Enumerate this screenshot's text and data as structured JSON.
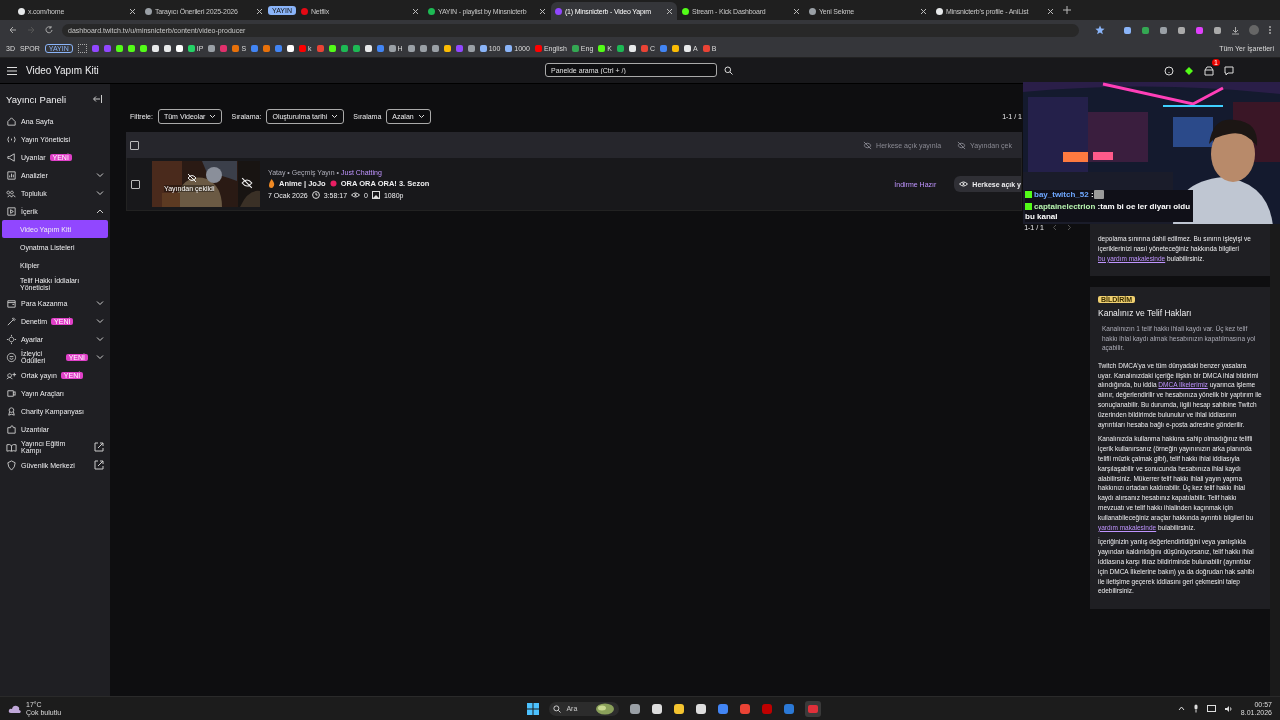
{
  "browser": {
    "tabs": [
      {
        "kind": "tab",
        "label": "x.com/home",
        "selected": false,
        "color": "#e7e9ea"
      },
      {
        "kind": "tab",
        "label": "Tarayıcı Önerileri 2025-2026",
        "selected": false,
        "color": "#9aa0a6"
      },
      {
        "kind": "group",
        "label": "YAYIN",
        "color": "#8ab4f8"
      },
      {
        "kind": "tab",
        "label": "Netflix",
        "selected": false,
        "color": "#e50914"
      },
      {
        "kind": "tab",
        "label": "YAYIN - playlist by Minsnicterb",
        "selected": false,
        "color": "#1db954"
      },
      {
        "kind": "tab",
        "label": "(1) Minsnicterb - Video Yapım",
        "selected": true,
        "color": "#9147ff"
      },
      {
        "kind": "tab",
        "label": "Stream - Kick Dashboard",
        "selected": false,
        "color": "#53fc18"
      },
      {
        "kind": "tab",
        "label": "Yeni Sekme",
        "selected": false,
        "color": "#9aa0a6"
      },
      {
        "kind": "tab",
        "label": "Minsnicterb's profile - AniList",
        "selected": false,
        "color": "#e7e9ea"
      }
    ],
    "url": "dashboard.twitch.tv/u/minsnicterb/content/video-producer",
    "bookmark_folders": [
      "3D",
      "SPOR"
    ],
    "bookmark_group": "YAYIN",
    "bookmarks": [
      {
        "color": "#9147ff"
      },
      {
        "color": "#9147ff"
      },
      {
        "color": "#53fc18"
      },
      {
        "color": "#53fc18"
      },
      {
        "color": "#53fc18"
      },
      {
        "color": "#e7e9ea"
      },
      {
        "color": "#e7e9ea"
      },
      {
        "color": "#ffffff"
      },
      {
        "color": "#25d366",
        "label": "IP"
      },
      {
        "color": "#9aa0a6"
      },
      {
        "color": "#e1306c"
      },
      {
        "color": "#e8710a",
        "label": "S"
      },
      {
        "color": "#4285f4"
      },
      {
        "color": "#e8710a"
      },
      {
        "color": "#4285f4"
      },
      {
        "color": "#ffffff"
      },
      {
        "color": "#ff0000",
        "label": "k"
      },
      {
        "color": "#ea4335"
      },
      {
        "color": "#53fc18"
      },
      {
        "color": "#1db954"
      },
      {
        "color": "#1db954"
      },
      {
        "color": "#e7e9ea"
      },
      {
        "color": "#4285f4"
      },
      {
        "color": "#9aa0a6",
        "label": "H"
      },
      {
        "color": "#9aa0a6"
      },
      {
        "color": "#9aa0a6"
      },
      {
        "color": "#9aa0a6"
      },
      {
        "color": "#fbbc04"
      },
      {
        "color": "#9147ff"
      },
      {
        "color": "#9aa0a6"
      },
      {
        "color": "#8ab4f8",
        "label": "100"
      },
      {
        "color": "#8ab4f8",
        "label": "1000"
      },
      {
        "color": "#ff0000",
        "label": "English"
      },
      {
        "color": "#34a853",
        "label": "Eng"
      },
      {
        "color": "#53fc18",
        "label": "K"
      },
      {
        "color": "#1db954"
      },
      {
        "color": "#e7e9ea"
      },
      {
        "color": "#ea4335",
        "label": "C"
      },
      {
        "color": "#4285f4"
      },
      {
        "color": "#fbbc04"
      },
      {
        "color": "#e7e9ea",
        "label": "A"
      },
      {
        "color": "#ea4335",
        "label": "B"
      }
    ],
    "all_bookmarks": "Tüm Yer İşaretleri"
  },
  "topbar": {
    "title": "Video Yapım Kiti",
    "search": {
      "placeholder": "Panelde arama (Ctrl + /)"
    },
    "notification_count": "1"
  },
  "sidebar": {
    "title": "Yayıncı Paneli",
    "items": [
      {
        "label": "Ana Sayfa",
        "selected": false
      },
      {
        "label": "Yayın Yöneticisi",
        "selected": false
      },
      {
        "label": "Uyarılar",
        "badge": "YENİ",
        "selected": false
      },
      {
        "label": "Analizler",
        "expanded": false,
        "selected": false
      },
      {
        "label": "Topluluk",
        "expanded": false,
        "selected": false
      },
      {
        "label": "İçerik",
        "expanded": true,
        "selected": false,
        "children": [
          {
            "label": "Video Yapım Kiti",
            "selected": true
          },
          {
            "label": "Oynatma Listeleri",
            "selected": false
          },
          {
            "label": "Klipler",
            "selected": false
          },
          {
            "label": "Telif Hakkı İddiaları Yöneticisi",
            "selected": false
          }
        ]
      },
      {
        "label": "Para Kazanma",
        "expanded": false,
        "selected": false
      },
      {
        "label": "Denetim",
        "badge": "YENİ",
        "expanded": false,
        "selected": false
      },
      {
        "label": "Ayarlar",
        "expanded": false,
        "selected": false
      },
      {
        "label": "İzleyici Ödülleri",
        "badge": "YENİ",
        "expanded": false,
        "selected": false
      },
      {
        "label": "Ortak yayın",
        "badge": "YENİ",
        "selected": false
      },
      {
        "label": "Yayın Araçları",
        "selected": false
      },
      {
        "label": "Charity Kampanyası",
        "selected": false
      },
      {
        "label": "Uzantılar",
        "selected": false
      },
      {
        "label": "Yayıncı Eğitim Kampı",
        "external": true,
        "selected": false
      },
      {
        "label": "Güvenlik Merkezi",
        "external": true,
        "selected": false
      }
    ]
  },
  "filters": [
    {
      "label": "Filtrele:",
      "value": "Tüm Videolar"
    },
    {
      "label": "Sıralama:",
      "value": "Oluşturulma tarihi"
    },
    {
      "label": "Sıralama",
      "value": "Azalan"
    }
  ],
  "page_count": "1-1 / 1",
  "table": {
    "header_checked": false,
    "actions": [
      {
        "label": "Herkese açık yayınla",
        "disabled": true
      },
      {
        "label": "Yayından çek",
        "disabled": true
      }
    ],
    "videos": [
      {
        "checked": false,
        "thumbnail_label": "Yayından çekildi",
        "meta": "Yatay • Geçmiş Yayın • ",
        "category": "Just Chatting",
        "title_prefix": "Anime | JoJo",
        "title": "ORA ORA ORA! 3. Sezon",
        "date": "7 Ocak 2026",
        "duration": "3:58:17",
        "views": "0",
        "quality": "1080p",
        "status": "İndirme Hazır",
        "action": "Herkese açık y"
      }
    ]
  },
  "bottom_page_count": "1-1 / 1",
  "overlay": {
    "kind": "picture",
    "chat": [
      {
        "user": "bay_twitch_52",
        "sep": ":",
        "color": "#6fa8ff"
      },
      {
        "user": "captainelectrion",
        "sep": ":",
        "message": "tam bi oe ler diyarı oldu bu kanal",
        "color": "#b8f5b0"
      }
    ]
  },
  "info_cards": [
    {
      "paragraphs": [
        [
          {
            "text": "depolama sınırına dahil edilmez. Bu sınırın işleyişi ve içeriklerinizi nasıl yöneteceğiniz hakkında bilgileri "
          },
          {
            "link": "bu yardım makalesinde"
          },
          {
            "text": " bulabilirsiniz."
          }
        ]
      ]
    },
    {
      "badge": "BİLDİRİM",
      "title": "Kanalınız ve Telif Hakları",
      "notice": "Kanalınızın 1 telif hakkı ihlali kaydı var. Üç kez telif hakkı ihlal kaydı almak hesabınızın kapatılmasına yol açabilir.",
      "paragraphs": [
        [
          {
            "text": "Twitch DMCA'ya ve tüm dünyadaki benzer yasalara uyar. Kanalınızdaki içeriğe ilişkin bir DMCA ihlal bildirimi alındığında, bu iddia "
          },
          {
            "link": "DMCA İlkelerimiz"
          },
          {
            "text": " uyarınca işleme alınır, değerlendirilir ve hesabınıza yönelik bir yaptırım ile sonuçlanabilir. Bu durumda, ilgili hesap sahibine Twitch üzerinden bildirimde bulunulur ve ihlal iddiasının ayrıntıları hesaba bağlı e-posta adresine gönderilir."
          }
        ],
        [
          {
            "text": "Kanalınızda kullanma hakkına sahip olmadığınız telifli içerik kullanırsanız (örneğin yayınınızın arka planında telifli müzik çalmak gibi), telif hakkı ihlal iddiasıyla karşılaşabilir ve sonucunda hesabınıza ihlal kaydı alabilirsiniz. Mükerrer telif hakkı ihlali yayın yapma hakkınızı ortadan kaldırabilir. Üç kez telif hakkı ihlal kaydı alırsanız hesabınız kapatılabilir. Telif hakkı mevzuatı ve telif hakkı ihlalinden kaçınmak için kullanabileceğiniz araçlar hakkında ayrıntılı bilgileri bu "
          },
          {
            "link": "yardım makalesinde"
          },
          {
            "text": " bulabilirsiniz."
          }
        ],
        [
          {
            "text": "İçeriğinizin yanlış değerlendirildiğini veya yanlışlıkla yayından kaldırıldığını düşünüyorsanız, telif hakkı ihlal iddiasına karşı itiraz bildiriminde bulunabilir (ayrıntılar için DMCA İlkelerine bakın) ya da doğrudan hak sahibi ile iletişime geçerek iddiasını geri çekmesini talep edebilirsiniz."
          }
        ]
      ]
    }
  ],
  "taskbar": {
    "weather": {
      "temp": "17°C",
      "desc": "Çok bulutlu"
    },
    "search": {
      "placeholder": "Ara"
    },
    "time": "00:57",
    "date": "8.01.2026"
  }
}
